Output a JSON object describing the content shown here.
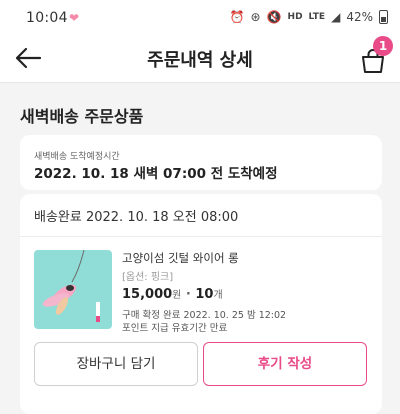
{
  "status_bar": {
    "time": "10:04",
    "battery": "42%",
    "network": "LTE",
    "hd": "HD"
  },
  "header": {
    "title": "주문내역 상세",
    "cart_count": "1"
  },
  "section": {
    "title": "새벽배송 주문상품"
  },
  "arrival": {
    "label": "새벽배송 도착예정시간",
    "value": "2022. 10. 18 새벽 07:00 전 도착예정"
  },
  "order": {
    "delivered": "배송완료 2022. 10. 18 오전 08:00",
    "product_name": "고양이섬 깃털 와이어 롱",
    "option": "[옵션: 핑크]",
    "price": "15,000",
    "currency": "원",
    "quantity": "10",
    "quantity_unit": "개",
    "confirm": "구매 확정 완료 2022. 10. 25 밤 12:02",
    "point": "포인트 지급 유효기간 만료"
  },
  "buttons": {
    "cart": "장바구니 담기",
    "review": "후기 작성"
  },
  "colors": {
    "accent": "#e94a88",
    "thumb_bg": "#8fddd6"
  }
}
